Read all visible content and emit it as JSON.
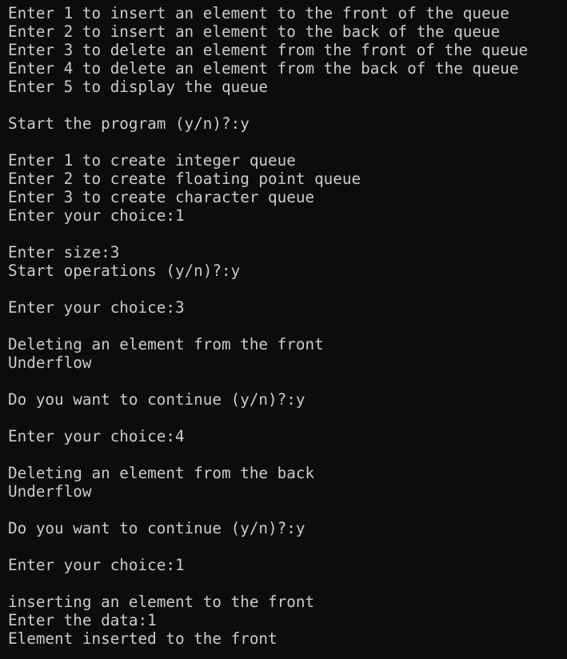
{
  "terminal": {
    "lines": [
      "Enter 1 to insert an element to the front of the queue",
      "Enter 2 to insert an element to the back of the queue",
      "Enter 3 to delete an element from the front of the queue",
      "Enter 4 to delete an element from the back of the queue",
      "Enter 5 to display the queue",
      "",
      "Start the program (y/n)?:y",
      "",
      "Enter 1 to create integer queue",
      "Enter 2 to create floating point queue",
      "Enter 3 to create character queue",
      "Enter your choice:1",
      "",
      "Enter size:3",
      "Start operations (y/n)?:y",
      "",
      "Enter your choice:3",
      "",
      "Deleting an element from the front",
      "Underflow",
      "",
      "Do you want to continue (y/n)?:y",
      "",
      "Enter your choice:4",
      "",
      "Deleting an element from the back",
      "Underflow",
      "",
      "Do you want to continue (y/n)?:y",
      "",
      "Enter your choice:1",
      "",
      "inserting an element to the front",
      "Enter the data:1",
      "Element inserted to the front"
    ],
    "colors": {
      "background": "#0c0c0c",
      "foreground": "#cccccc"
    }
  }
}
